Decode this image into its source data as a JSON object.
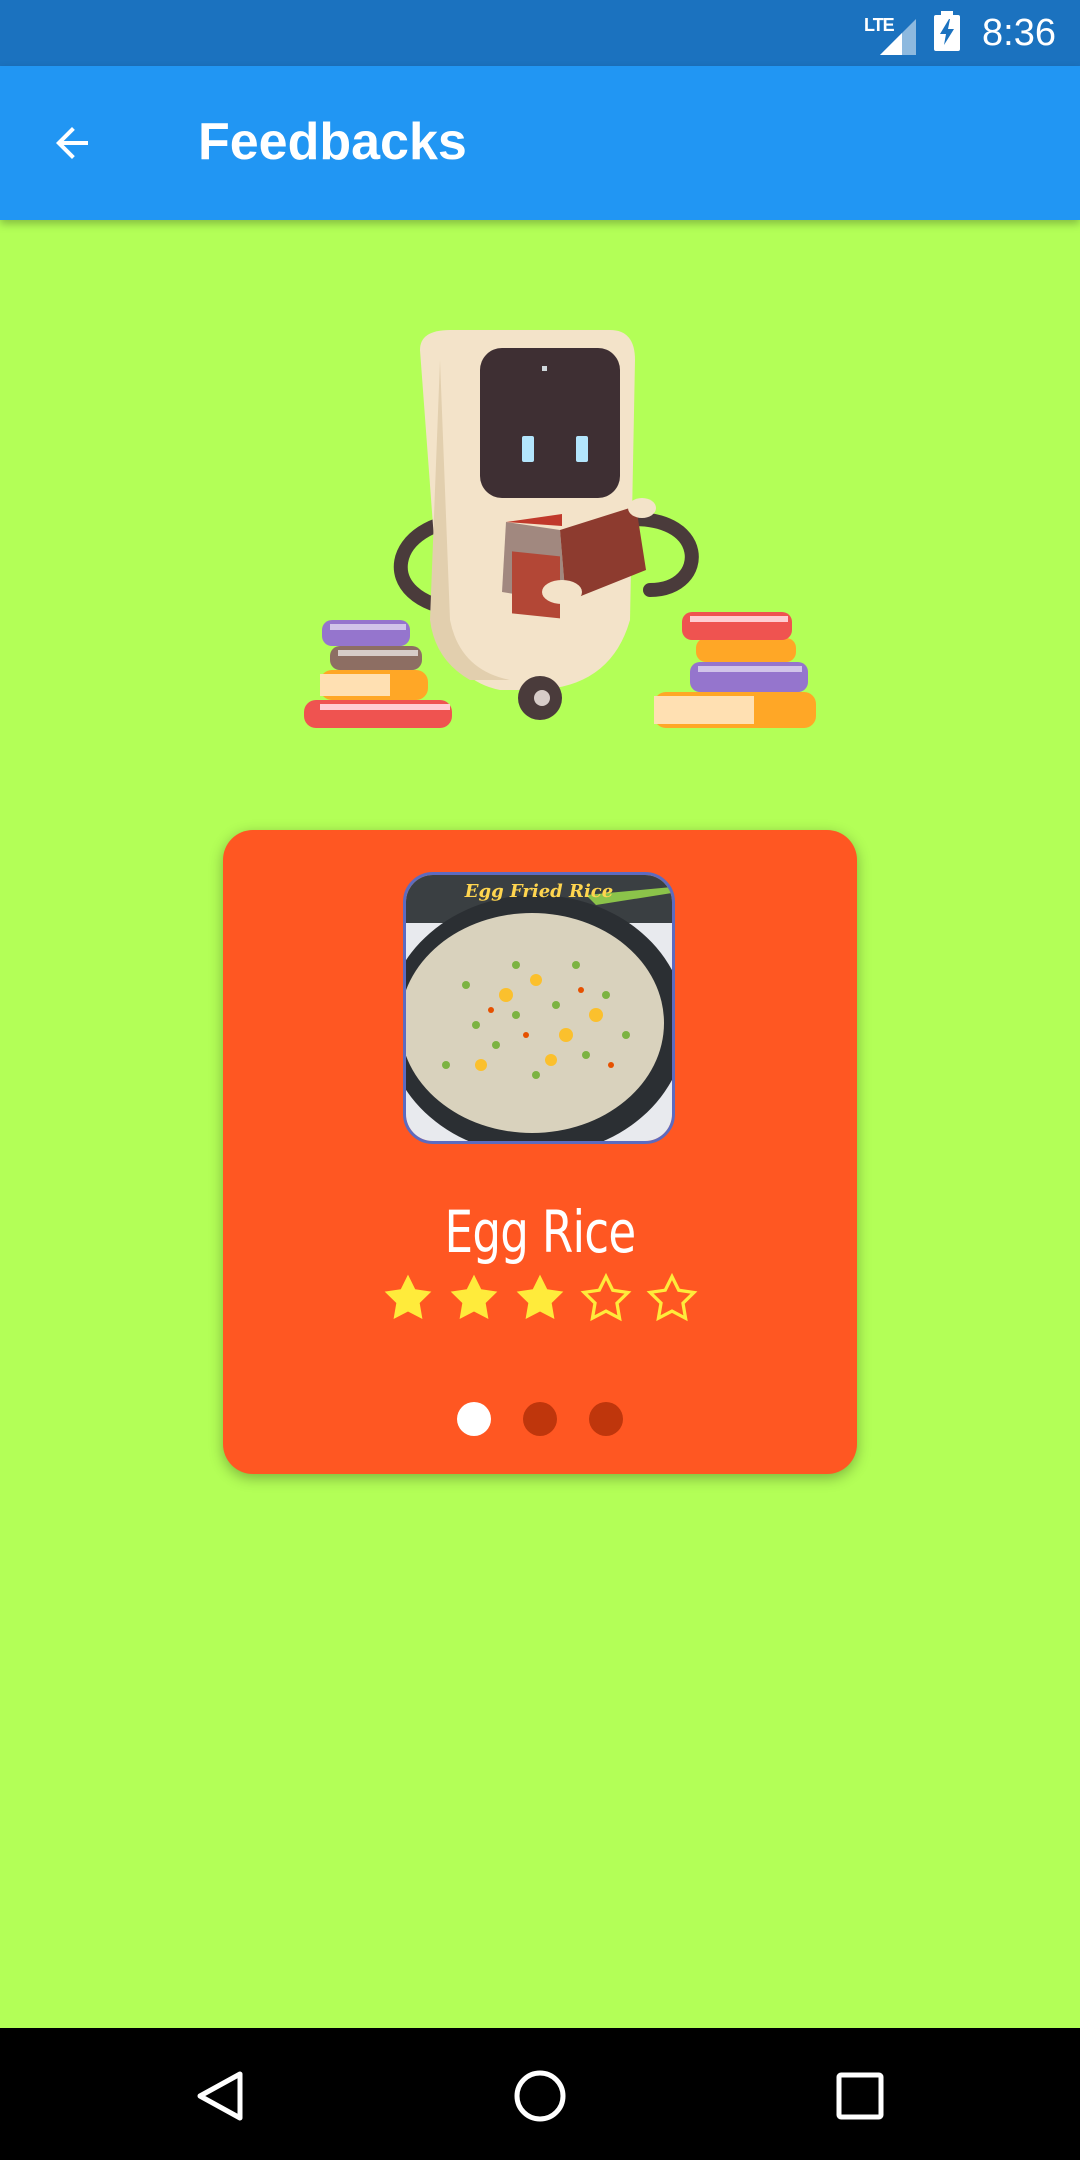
{
  "status_bar": {
    "network": "LTE",
    "time": "8:36"
  },
  "app_bar": {
    "title": "Feedbacks",
    "back_icon": "arrow-back-icon"
  },
  "illustration": {
    "icon": "robot-reading-books-illustration"
  },
  "card": {
    "food_image_caption": "Egg Fried Rice",
    "food_name": "Egg Rice",
    "rating": 3,
    "rating_max": 5,
    "pages": 3,
    "active_page": 1
  },
  "colors": {
    "status_bar": "#1b72bf",
    "app_bar": "#2196f3",
    "background": "#b3ff57",
    "card": "#ff5722",
    "star": "#ffeb3b"
  },
  "nav_bar": {
    "back_icon": "nav-back-icon",
    "home_icon": "nav-home-icon",
    "recents_icon": "nav-recents-icon"
  }
}
